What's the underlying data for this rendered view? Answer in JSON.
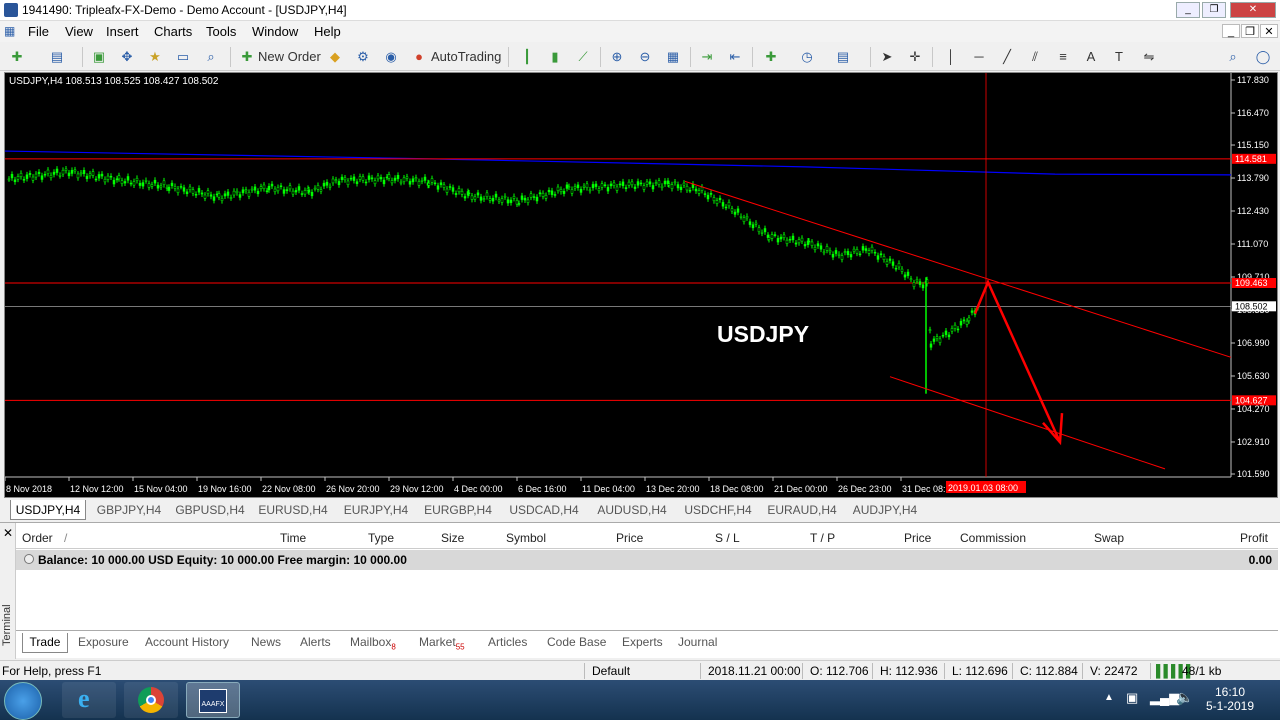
{
  "window": {
    "title": "1941490: Tripleafx-FX-Demo - Demo Account - [USDJPY,H4]"
  },
  "menu": {
    "items": [
      "File",
      "View",
      "Insert",
      "Charts",
      "Tools",
      "Window",
      "Help"
    ]
  },
  "toolbar": {
    "new_order": "New Order",
    "autotrading": "AutoTrading"
  },
  "chart": {
    "info": "USDJPY,H4  108.513 108.525 108.427 108.502",
    "overlay_label": "USDJPY",
    "colors": {
      "background": "#000000",
      "candles": "#00ff00",
      "ma": "#0000ff",
      "levels": "#ff0000",
      "bid": "#c0c0c0",
      "text": "#ffffff"
    },
    "price_ticks": [
      "117.830",
      "116.470",
      "115.150",
      "113.790",
      "112.430",
      "111.070",
      "109.710",
      "108.350",
      "106.990",
      "105.630",
      "104.270",
      "102.910",
      "101.590"
    ],
    "time_ticks": [
      "8 Nov 2018",
      "12 Nov 12:00",
      "15 Nov 04:00",
      "19 Nov 16:00",
      "22 Nov 08:00",
      "26 Nov 20:00",
      "29 Nov 12:00",
      "4 Dec 00:00",
      "6 Dec 16:00",
      "11 Dec 04:00",
      "13 Dec 20:00",
      "18 Dec 08:00",
      "21 Dec 00:00",
      "26 Dec 23:00",
      "31 Dec 08:"
    ],
    "cursor_time": "2019.01.03 08:00",
    "price_labels": {
      "upper_level": "114.581",
      "mid_level": "109.463",
      "bid": "108.502",
      "lower_level": "104.627"
    }
  },
  "chart_tabs": [
    "USDJPY,H4",
    "GBPJPY,H4",
    "GBPUSD,H4",
    "EURUSD,H4",
    "EURJPY,H4",
    "EURGBP,H4",
    "USDCAD,H4",
    "AUDUSD,H4",
    "USDCHF,H4",
    "EURAUD,H4",
    "AUDJPY,H4"
  ],
  "terminal": {
    "side_label": "Terminal",
    "columns": [
      "Order",
      "/",
      "Time",
      "Type",
      "Size",
      "Symbol",
      "Price",
      "S / L",
      "T / P",
      "Price",
      "Commission",
      "Swap",
      "Profit"
    ],
    "balance": "Balance: 10 000.00 USD  Equity: 10 000.00  Free margin: 10 000.00",
    "profit": "0.00",
    "tabs": [
      {
        "label": "Trade",
        "badge": ""
      },
      {
        "label": "Exposure",
        "badge": ""
      },
      {
        "label": "Account History",
        "badge": ""
      },
      {
        "label": "News",
        "badge": ""
      },
      {
        "label": "Alerts",
        "badge": ""
      },
      {
        "label": "Mailbox",
        "badge": "8"
      },
      {
        "label": "Market",
        "badge": "55"
      },
      {
        "label": "Articles",
        "badge": ""
      },
      {
        "label": "Code Base",
        "badge": ""
      },
      {
        "label": "Experts",
        "badge": ""
      },
      {
        "label": "Journal",
        "badge": ""
      }
    ]
  },
  "status": {
    "help": "For Help, press F1",
    "profile": "Default",
    "datetime": "2018.11.21 00:00",
    "open": "O: 112.706",
    "high": "H: 112.936",
    "low": "L: 112.696",
    "close": "C: 112.884",
    "volume": "V: 22472",
    "traffic": "48/1 kb"
  },
  "taskbar": {
    "time": "16:10",
    "date": "5-1-2019",
    "app_label": "AAAFX"
  }
}
